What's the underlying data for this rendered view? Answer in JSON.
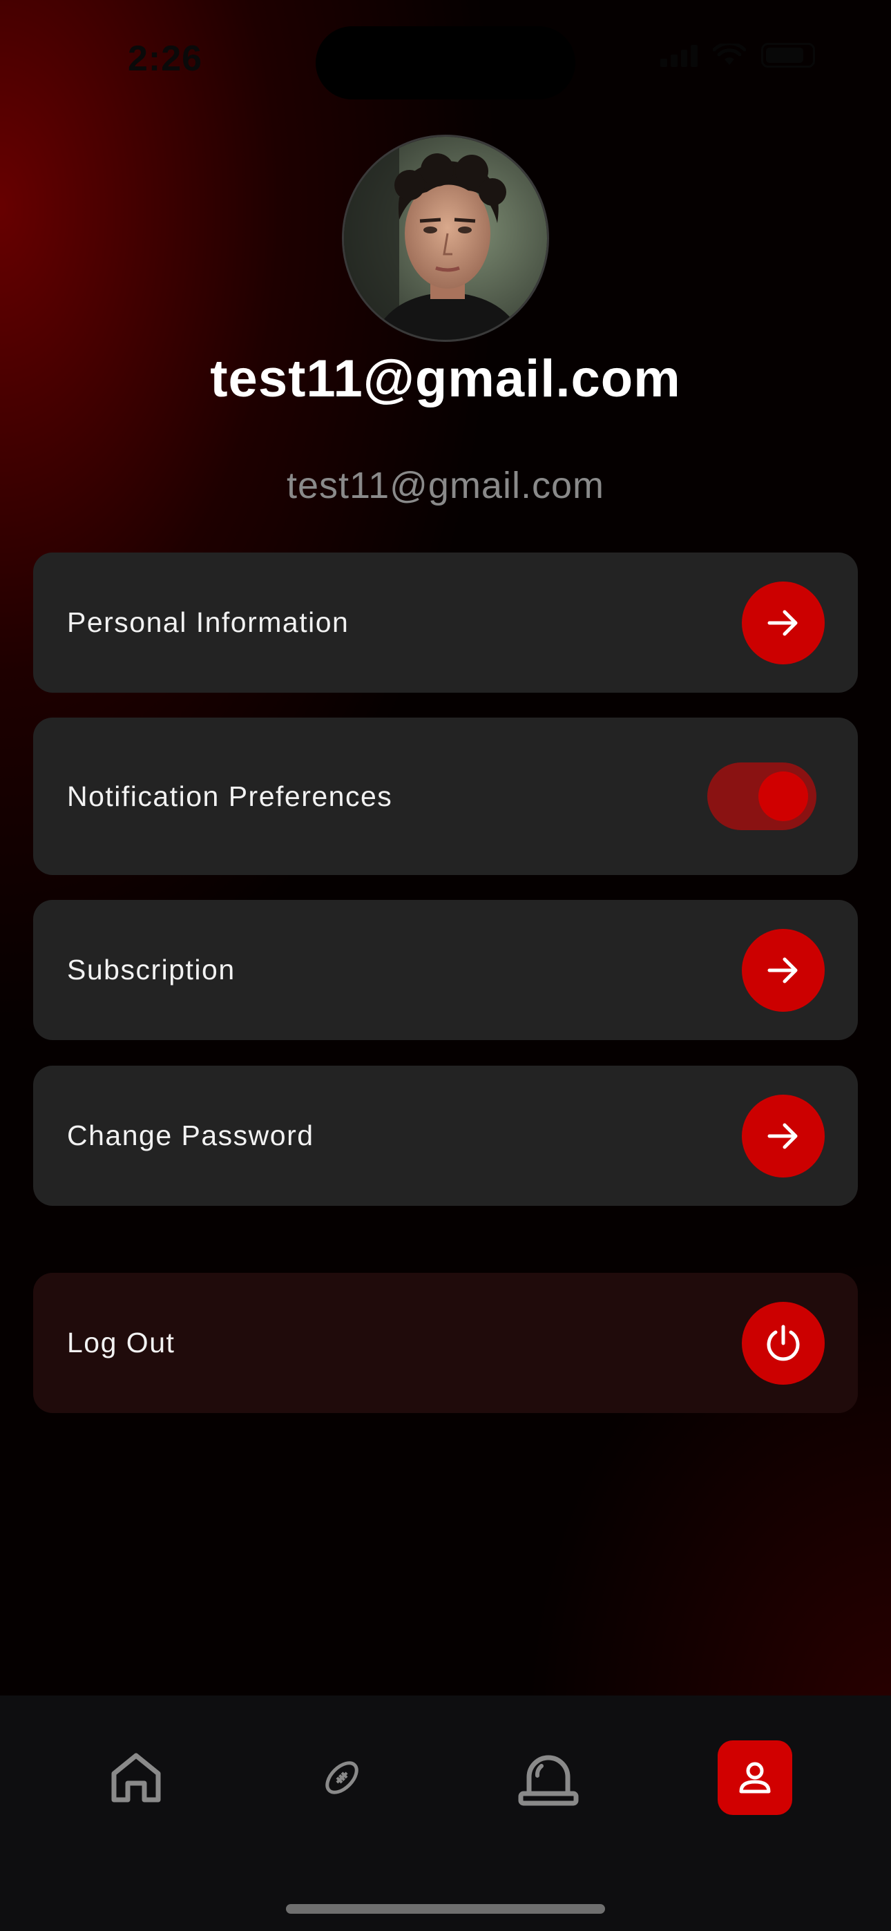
{
  "status_bar": {
    "time": "2:26"
  },
  "profile": {
    "name": "test11@gmail.com",
    "email": "test11@gmail.com"
  },
  "menu": {
    "personal_information": "Personal Information",
    "notification_preferences": "Notification Preferences",
    "notifications_enabled": true,
    "subscription": "Subscription",
    "change_password": "Change Password",
    "log_out": "Log Out"
  },
  "bottom_nav": {
    "items": [
      "home-icon",
      "football-icon",
      "siren-icon",
      "profile-icon"
    ],
    "active": "profile-icon"
  },
  "colors": {
    "accent": "#cc0000",
    "card": "#232323",
    "logout_card": "#200b0b",
    "nav_bar": "#0e0e10"
  }
}
